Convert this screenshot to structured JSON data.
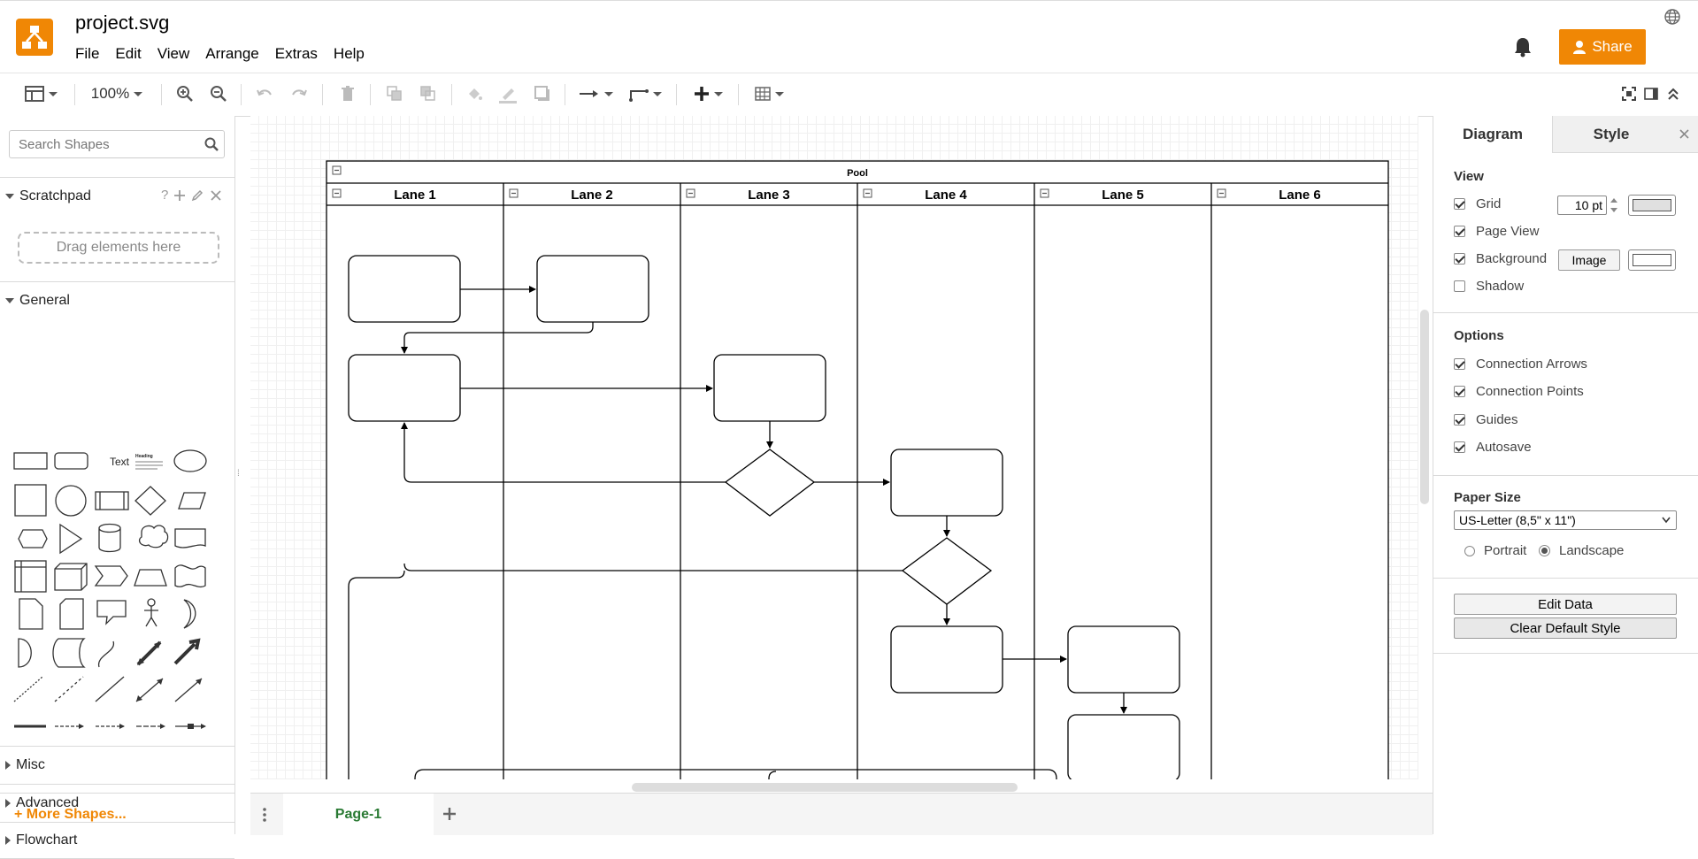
{
  "app": {
    "file_title": "project.svg",
    "menus": [
      "File",
      "Edit",
      "View",
      "Arrange",
      "Extras",
      "Help"
    ],
    "share_label": "Share"
  },
  "toolbar": {
    "zoom": "100%"
  },
  "sidebar": {
    "search_placeholder": "Search Shapes",
    "scratchpad_title": "Scratchpad",
    "scratchpad_help": "?",
    "drag_hint": "Drag elements here",
    "sections": {
      "general": "General",
      "misc": "Misc",
      "advanced": "Advanced",
      "flowchart": "Flowchart"
    },
    "text_shape_label": "Text",
    "heading_shape_label": "Heading",
    "more_shapes": "+ More Shapes..."
  },
  "diagram": {
    "pool_title": "Pool",
    "lanes": [
      "Lane 1",
      "Lane 2",
      "Lane 3",
      "Lane 4",
      "Lane 5",
      "Lane 6"
    ]
  },
  "pages": {
    "current": "Page-1"
  },
  "format_panel": {
    "tabs": [
      "Diagram",
      "Style"
    ],
    "view_heading": "View",
    "grid_label": "Grid",
    "grid_size": "10 pt",
    "page_view_label": "Page View",
    "background_label": "Background",
    "image_button": "Image",
    "shadow_label": "Shadow",
    "options_heading": "Options",
    "options": [
      "Connection Arrows",
      "Connection Points",
      "Guides",
      "Autosave"
    ],
    "paper_size_heading": "Paper Size",
    "paper_size": "US-Letter (8,5\" x 11\")",
    "orientation": [
      "Portrait",
      "Landscape"
    ],
    "orientation_selected": "Landscape",
    "edit_data": "Edit Data",
    "clear_default_style": "Clear Default Style",
    "checked": {
      "grid": true,
      "page_view": true,
      "background": true,
      "shadow": false,
      "connection_arrows": true,
      "connection_points": true,
      "guides": true,
      "autosave": true
    }
  },
  "colors": {
    "accent": "#f08705",
    "page_tab_text": "#2a7a33",
    "more_shapes": "#f08705"
  }
}
